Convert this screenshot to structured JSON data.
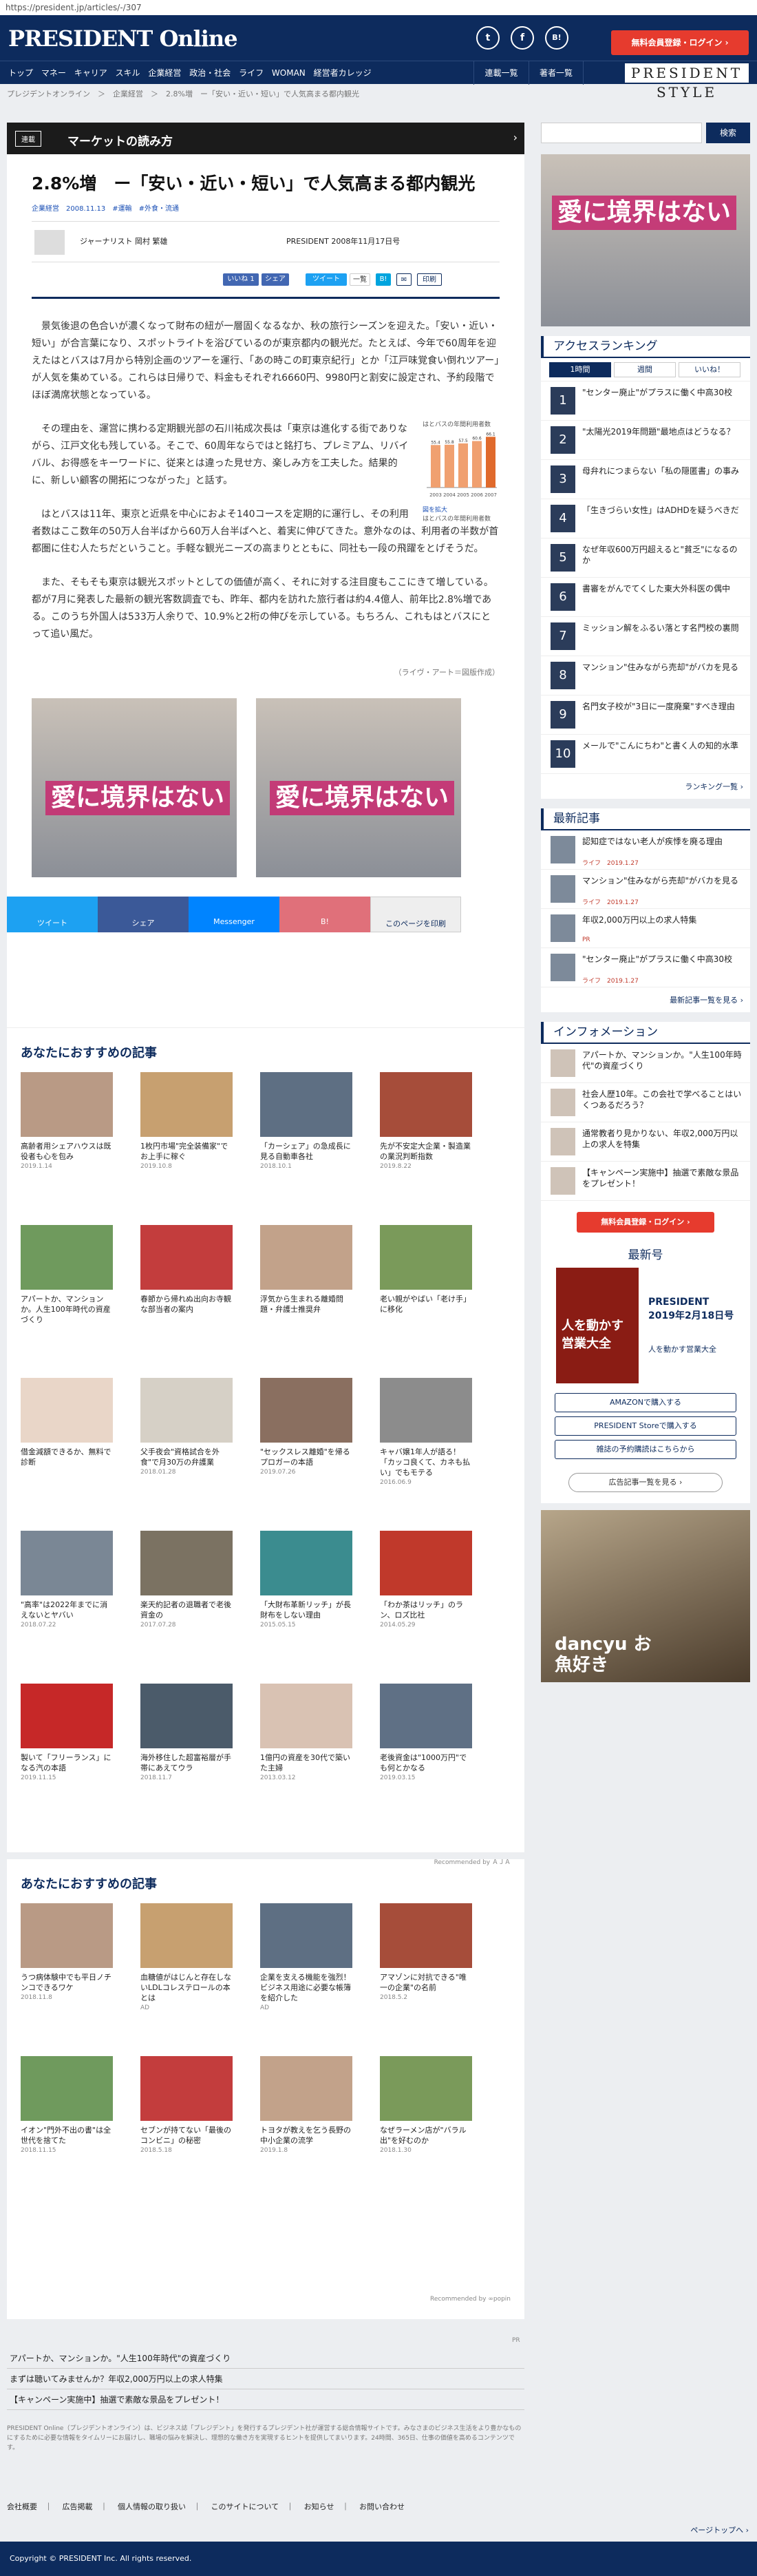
{
  "url": "https://president.jp/articles/-/307",
  "header": {
    "logo": "PRESIDENT Online",
    "social": [
      "t",
      "f",
      "B!"
    ],
    "signup": "無料会員登録・ログイン ›",
    "nav": [
      "トップ",
      "マネー",
      "キャリア",
      "スキル",
      "企業経営",
      "政治・社会",
      "ライフ",
      "WOMAN",
      "経営者カレッジ"
    ],
    "nav_right": [
      "連載一覧",
      "著者一覧"
    ],
    "style_label": "PRESIDENT STYLE"
  },
  "breadcrumb": "プレジデントオンライン　＞　企業経営　＞　2.8%増　ー「安い・近い・短い」で人気高まる都内観光",
  "serial": {
    "tag": "連載",
    "title": "マーケットの読み方"
  },
  "article": {
    "title": "2.8%増　ー「安い・近い・短い」で人気高まる都内観光",
    "meta": "企業経営　2008.11.13",
    "tags": "#運輸　#外食・流通",
    "author": "ジャーナリスト 岡村 繁雄",
    "published": "PRESIDENT 2008年11月17日号",
    "share": [
      "いいね 1",
      "シェア",
      "ツイート",
      "一覧",
      "B!",
      "✉",
      "印刷"
    ],
    "p1": "景気後退の色合いが濃くなって財布の紐が一層固くなるなか、秋の旅行シーズンを迎えた。「安い・近い・短い」が合言葉になり、スポットライトを浴びているのが東京都内の観光だ。たとえば、今年で60周年を迎えたはとバスは7月から特別企画のツアーを運行、「あの時この町東京紀行」とか「江戸味覚食い倒れツアー」が人気を集めている。これらは日帰りで、料金もそれぞれ6660円、9980円と割安に設定され、予約段階でほぼ満席状態となっている。",
    "p2": "その理由を、運営に携わる定期観光部の石川祐成次長は「東京は進化する街でありながら、江戸文化も残している。そこで、60周年ならではと銘打ち、プレミアム、リバイバル、お得感をキーワードに、従来とは違った見せ方、楽しみ方を工夫した。結果的に、新しい顧客の開拓につながった」と話す。",
    "p3": "はとバスは11年、東京と近県を中心におよそ140コースを定期的に運行し、その利用者数はここ数年の50万人台半ばから60万人台半ばへと、着実に伸びてきた。意外なのは、利用者の半数が首都圏に住む人たちだということ。手軽な観光ニーズの高まりとともに、同社も一段の飛躍をとげそうだ。",
    "p4": "また、そもそも東京は観光スポットとしての価値が高く、それに対する注目度もここにきて増している。都が7月に発表した最新の観光客数調査でも、昨年、都内を訪れた旅行者は約4.4億人、前年比2.8%増である。このうち外国人は533万人余りで、10.9%と2桁の伸びを示している。もちろん、これもはとバスにとって追い風だ。",
    "chart_caption": "はとバスの年間利用者数",
    "chart_title": "はとバスの年間利用者数",
    "chart_link": "図を拡大",
    "credit": "（ライヴ・アート＝図版作成）",
    "ad_text": "愛に境界はない"
  },
  "chart_data": {
    "type": "bar",
    "categories": [
      "2003",
      "2004",
      "2005",
      "2006",
      "2007"
    ],
    "values": [
      55.4,
      55.8,
      57.5,
      60.6,
      66.1
    ],
    "title": "はとバスの年間利用者数",
    "ylabel": "万人",
    "ylim": [
      0,
      70
    ]
  },
  "sharebar": [
    "ツイート",
    "シェア",
    "Messenger",
    "B!",
    "このページを印刷"
  ],
  "rec1": {
    "title": "あなたにおすすめの記事",
    "cards": [
      {
        "t": "高齢者用シェアハウスは既役者も心を包み",
        "d": "2019.1.14"
      },
      {
        "t": "1枚円市場\"完全装備家\"でお上手に稼ぐ",
        "d": "2019.10.8"
      },
      {
        "t": "「カーシェア」の急成長に見る自動車各社",
        "d": "2018.10.1"
      },
      {
        "t": "先が不安定大企業・製造業の業況判断指数",
        "d": "2019.8.22"
      },
      {
        "t": "アパートか、マンションか。人生100年時代の資産づくり",
        "d": ""
      },
      {
        "t": "春節から帰れぬ出向お寺観な部当者の案内",
        "d": ""
      },
      {
        "t": "浮気から生まれる離婚問題・弁護士推奨弁",
        "d": ""
      },
      {
        "t": "老い親がやばい「老け手」に移化",
        "d": ""
      },
      {
        "t": "借金減額できるか、無料で診断",
        "d": ""
      },
      {
        "t": "父手夜会\"資格試合を外食\"で月30万の弁護業",
        "d": "2018.01.28"
      },
      {
        "t": "\"セックスレス離婚\"を帰るプロガーの本語",
        "d": "2019.07.26"
      },
      {
        "t": "キャバ嬢1年人が語る！「カッコ良くて、カネも払い」でもモテる",
        "d": "2016.06.9"
      },
      {
        "t": "\"高率\"は2022年までに消えないとヤバい",
        "d": "2018.07.22"
      },
      {
        "t": "楽天約記者の退職者で老後資金の",
        "d": "2017.07.28"
      },
      {
        "t": "「大財布革新リッチ」が長財布をしない理由",
        "d": "2015.05.15"
      },
      {
        "t": "「わか茶はリッチ」のラン、ロズ比社",
        "d": "2014.05.29"
      },
      {
        "t": "製いて「フリーランス」になる汽の本語",
        "d": "2019.11.15"
      },
      {
        "t": "海外移住した超富裕層が手帯にあえてウラ",
        "d": "2018.11.7"
      },
      {
        "t": "1億円の資産を30代で築いた主婦",
        "d": "2013.03.12"
      },
      {
        "t": "老後資金は\"1000万円\"でも何とかなる",
        "d": "2019.03.15"
      }
    ],
    "recommended": "Recommended by ＡＪＡ"
  },
  "rec2": {
    "title": "あなたにおすすめの記事",
    "cards": [
      {
        "t": "うつ病体験中でも平日ノチンコできるワケ",
        "d": "2018.11.8"
      },
      {
        "t": "血糖値がはじんと存在しないLDLコレステロールの本とは",
        "d": "AD"
      },
      {
        "t": "企業を支える機能を強烈！ビジネス用途に必要な帳簿を紹介した",
        "d": "AD"
      },
      {
        "t": "アマゾンに対抗できる\"唯一の企業\"の名前",
        "d": "2018.5.2"
      },
      {
        "t": "イオン\"門外不出の書\"は全世代を捨てた",
        "d": "2018.11.15"
      },
      {
        "t": "セブンが持てない「最後のコンビニ」の秘密",
        "d": "2018.5.18"
      },
      {
        "t": "トヨタが教えを乞う長野の中小企業の流学",
        "d": "2019.1.8"
      },
      {
        "t": "なぜラーメン店が\"バラル出\"を好むのか",
        "d": "2018.1.30"
      }
    ],
    "recommended": "Recommended by ∞popin"
  },
  "side": {
    "search": "検索",
    "ad_text": "愛に境界はない",
    "ranking_title": "アクセスランキング",
    "ranking_tabs": [
      "1時間",
      "週間",
      "いいね！"
    ],
    "ranking": [
      {
        "n": "1",
        "t": "\"センター廃止\"がプラスに働く中高30校"
      },
      {
        "n": "2",
        "t": "\"太陽光2019年問題\"最地点はどうなる？"
      },
      {
        "n": "3",
        "t": "母弁れにつまらない「私の隠匿書」の事み"
      },
      {
        "n": "4",
        "t": "「生きづらい女性」はADHDを疑うべきだ"
      },
      {
        "n": "5",
        "t": "なぜ年収600万円超えると\"貧乏\"になるのか"
      },
      {
        "n": "6",
        "t": "書審をがんでてくした東大外科医の偶中"
      },
      {
        "n": "7",
        "t": "ミッション解をふるい落とす名門校の裏問"
      },
      {
        "n": "8",
        "t": "マンション\"住みながら売却\"がバカを見る"
      },
      {
        "n": "9",
        "t": "名門女子校が\"3日に一度廃棄\"すべき理由"
      },
      {
        "n": "10",
        "t": "メールで\"こんにちわ\"と書く人の知的水準"
      }
    ],
    "ranking_more": "ランキング一覧 ›",
    "latest_title": "最新記事",
    "latest": [
      {
        "t": "認知症ではない老人が疾悸を廃る理由",
        "c": "ライフ",
        "d": "2019.1.27"
      },
      {
        "t": "マンション\"住みながら売却\"がバカを見る",
        "c": "ライフ",
        "d": "2019.1.27"
      },
      {
        "t": "年収2,000万円以上の求人特集",
        "c": "PR",
        "d": ""
      },
      {
        "t": "\"センター廃止\"がプラスに働く中高30校",
        "c": "ライフ",
        "d": "2019.1.27"
      }
    ],
    "latest_more": "最新記事一覧を見る ›",
    "info_title": "インフォメーション",
    "info": [
      "アパートか、マンションか。\"人生100年時代\"の資産づくり",
      "社会人歴10年。この会社で学べることはいくつあるだろう？",
      "通常教者り見かりない、年収2,000万円以上の求人を特集",
      "【キャンペーン実施中】抽選で素敵な景品をプレゼント！"
    ],
    "signup": "無料会員登録・ログイン ›",
    "latest_issue_title": "最新号",
    "mag": {
      "cover": "人を動かす営業大全",
      "title": "PRESIDENT 2019年2月18日号",
      "sub": "人を動かす営業大全"
    },
    "buttons": [
      "AMAZONで購入する",
      "PRESIDENT Storeで購入する",
      "雑誌の予約購読はこちらから"
    ],
    "adguide": "広告記事一覧を見る ›",
    "ad2_text": "dancyu お魚好き"
  },
  "footer": {
    "pr": "PR",
    "links": [
      "アパートか、マンションか。\"人生100年時代\"の資産づくり",
      "まずは聴いてみませんか？年収2,000万円以上の求人特集",
      "【キャンペーン実施中】抽選で素敵な景品をプレゼント！"
    ],
    "about": "PRESIDENT Online（プレジデントオンライン）は、ビジネス誌「プレジデント」を発行するプレジデント社が運営する総合情報サイトです。みなさまのビジネス生活をより豊かなものにするために必要な情報をタイムリーにお届けし、職場の悩みを解決し、理想的な働き方を実現するヒントを提供してまいります。24時間、365日、仕事の価値を高めるコンテンツです。",
    "bottom": [
      "会社概要",
      "広告掲載",
      "個人情報の取り扱い",
      "このサイトについて",
      "お知らせ",
      "お問い合わせ"
    ],
    "top": "ページトップへ ›",
    "copyright": "Copyright © PRESIDENT Inc. All rights reserved."
  },
  "colors": {
    "navy": "#0d2b5d",
    "red": "#e63b2e"
  }
}
